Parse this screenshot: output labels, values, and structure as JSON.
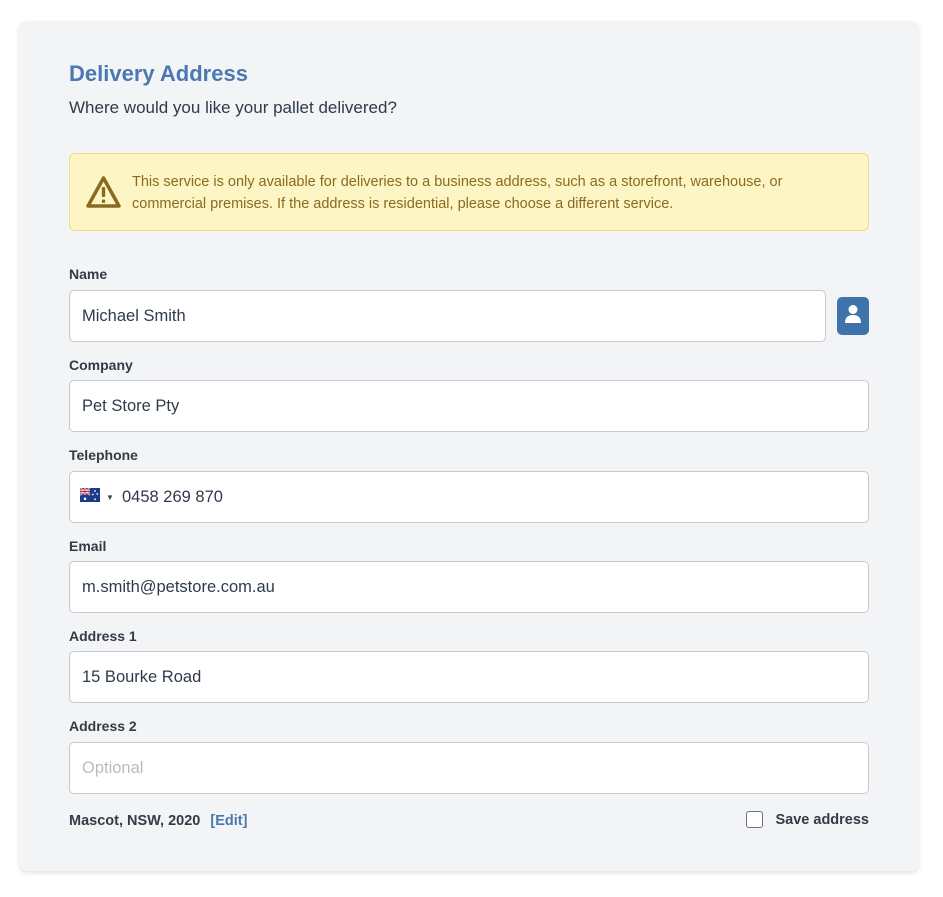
{
  "header": {
    "title": "Delivery Address",
    "subtitle": "Where would you like your pallet delivered?"
  },
  "warning": {
    "icon": "warning-triangle-icon",
    "text": "This service is only available for deliveries to a business address, such as a storefront, warehouse, or commercial premises. If the address is residential, please choose a different service.",
    "color": "#8a6a1f",
    "background": "#fdf6c4"
  },
  "fields": {
    "name": {
      "label": "Name",
      "value": "Michael Smith"
    },
    "company": {
      "label": "Company",
      "value": "Pet Store Pty"
    },
    "telephone": {
      "label": "Telephone",
      "country_flag": "australia-flag-icon",
      "value": "0458 269 870"
    },
    "email": {
      "label": "Email",
      "value": "m.smith@petstore.com.au"
    },
    "address1": {
      "label": "Address 1",
      "value": "15 Bourke Road"
    },
    "address2": {
      "label": "Address 2",
      "value": "",
      "placeholder": "Optional"
    }
  },
  "footer": {
    "locality": "Mascot, NSW, 2020",
    "edit_label": "[Edit]",
    "save_label": "Save address",
    "save_checked": false
  },
  "colors": {
    "accent": "#4a78b0",
    "contact_button": "#3f73ac"
  }
}
